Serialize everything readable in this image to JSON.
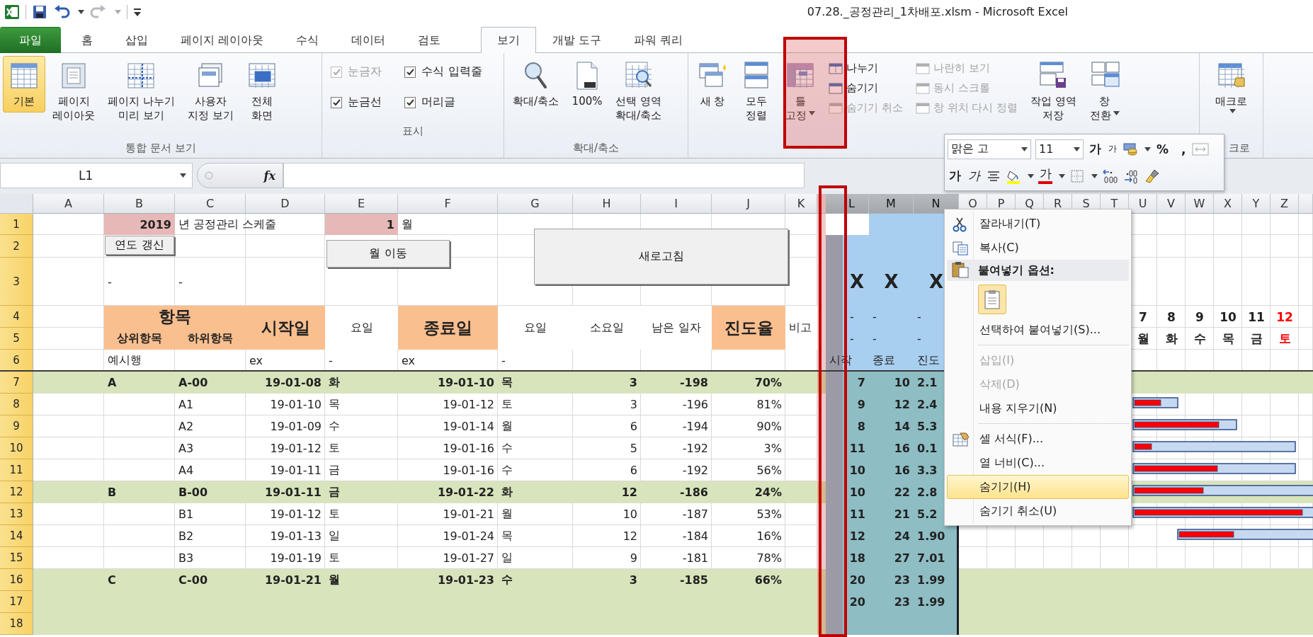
{
  "window": {
    "title": "07.28._공정관리_1차배포.xlsm  -  Microsoft Excel"
  },
  "tabs": [
    {
      "label": "파일",
      "kind": "file",
      "selected": false
    },
    {
      "label": "홈",
      "kind": "normal",
      "selected": false
    },
    {
      "label": "삽입",
      "kind": "normal",
      "selected": false
    },
    {
      "label": "페이지 레이아웃",
      "kind": "normal",
      "selected": false
    },
    {
      "label": "수식",
      "kind": "normal",
      "selected": false
    },
    {
      "label": "데이터",
      "kind": "normal",
      "selected": false
    },
    {
      "label": "검토",
      "kind": "normal",
      "selected": false
    },
    {
      "label": "보기",
      "kind": "normal",
      "selected": true
    },
    {
      "label": "개발 도구",
      "kind": "normal",
      "selected": false
    },
    {
      "label": "파워 쿼리",
      "kind": "normal",
      "selected": false
    }
  ],
  "ribbon": {
    "groups": [
      {
        "label": "통합 문서 보기",
        "items": [
          {
            "kind": "large",
            "lines": [
              "기본"
            ],
            "selected": true,
            "dropdown": false
          },
          {
            "kind": "large",
            "lines": [
              "페이지",
              "레이아웃"
            ],
            "selected": false,
            "dropdown": false
          },
          {
            "kind": "large",
            "lines": [
              "페이지 나누기",
              "미리 보기"
            ],
            "selected": false,
            "dropdown": false
          },
          {
            "kind": "large",
            "lines": [
              "사용자",
              "지정 보기"
            ],
            "selected": false,
            "dropdown": false
          },
          {
            "kind": "large",
            "lines": [
              "전체",
              "화면"
            ],
            "selected": false,
            "dropdown": false
          }
        ]
      },
      {
        "label": "표시",
        "items": [
          {
            "kind": "check",
            "label": "눈금자",
            "checked": true,
            "disabled": true
          },
          {
            "kind": "check",
            "label": "수식 입력줄",
            "checked": true,
            "disabled": false
          },
          {
            "kind": "check",
            "label": "눈금선",
            "checked": true,
            "disabled": false
          },
          {
            "kind": "check",
            "label": "머리글",
            "checked": true,
            "disabled": false
          }
        ]
      },
      {
        "label": "확대/축소",
        "items": [
          {
            "kind": "large",
            "lines": [
              "확대/축소"
            ],
            "selected": false,
            "dropdown": false
          },
          {
            "kind": "large",
            "lines": [
              "100%"
            ],
            "selected": false,
            "dropdown": false
          },
          {
            "kind": "large",
            "lines": [
              "선택 영역",
              "확대/축소"
            ],
            "selected": false,
            "dropdown": false
          }
        ]
      },
      {
        "items": [
          {
            "kind": "large",
            "lines": [
              "새 창"
            ],
            "selected": false,
            "dropdown": false
          },
          {
            "kind": "large",
            "lines": [
              "모두",
              "정렬"
            ],
            "selected": false,
            "dropdown": false
          },
          {
            "kind": "large",
            "lines": [
              "틀",
              "고정"
            ],
            "selected": false,
            "dropdown": true
          },
          {
            "kind": "stack",
            "items": [
              {
                "label": "나누기",
                "disabled": false
              },
              {
                "label": "숨기기",
                "disabled": false
              },
              {
                "label": "숨기기 취소",
                "disabled": true
              }
            ]
          },
          {
            "kind": "stack",
            "items": [
              {
                "label": "나란히 보기",
                "disabled": true
              },
              {
                "label": "동시 스크롤",
                "disabled": true
              },
              {
                "label": "창 위치 다시 정렬",
                "disabled": true
              }
            ]
          },
          {
            "kind": "large",
            "lines": [
              "작업 영역",
              "저장"
            ],
            "selected": false,
            "dropdown": false
          },
          {
            "kind": "large",
            "lines": [
              "창",
              "전환"
            ],
            "selected": false,
            "dropdown": true
          }
        ]
      },
      {
        "label": "크로",
        "items": [
          {
            "kind": "large",
            "lines": [
              "매크로"
            ],
            "selected": false,
            "dropdown": true
          }
        ]
      }
    ]
  },
  "formula_bar": {
    "name_box": "L1",
    "function_label": "fx"
  },
  "sheet": {
    "columns": [
      {
        "label": "A",
        "selected": false
      },
      {
        "label": "B",
        "selected": false
      },
      {
        "label": "C",
        "selected": false
      },
      {
        "label": "D",
        "selected": false
      },
      {
        "label": "E",
        "selected": false
      },
      {
        "label": "F",
        "selected": false
      },
      {
        "label": "G",
        "selected": false
      },
      {
        "label": "H",
        "selected": false
      },
      {
        "label": "I",
        "selected": false
      },
      {
        "label": "J",
        "selected": false
      },
      {
        "label": "K",
        "selected": false
      },
      {
        "label": "L",
        "selected": true
      },
      {
        "label": "M",
        "selected": true
      },
      {
        "label": "N",
        "selected": true
      },
      {
        "label": "O",
        "selected": false
      },
      {
        "label": "P",
        "selected": false
      },
      {
        "label": "Q",
        "selected": false
      },
      {
        "label": "R",
        "selected": false
      },
      {
        "label": "S",
        "selected": false
      },
      {
        "label": "T",
        "selected": false
      },
      {
        "label": "U",
        "selected": false
      },
      {
        "label": "V",
        "selected": false
      },
      {
        "label": "W",
        "selected": false
      },
      {
        "label": "X",
        "selected": false
      },
      {
        "label": "Y",
        "selected": false
      },
      {
        "label": "Z",
        "selected": false
      }
    ],
    "row_numbers": [
      {
        "label": "1",
        "selected": true
      },
      {
        "label": "2",
        "selected": true
      },
      {
        "label": "3",
        "selected": true
      },
      {
        "label": "4",
        "selected": true
      },
      {
        "label": "5",
        "selected": true
      },
      {
        "label": "6",
        "selected": true
      },
      {
        "label": "7",
        "selected": true
      },
      {
        "label": "8",
        "selected": true
      },
      {
        "label": "9",
        "selected": true
      },
      {
        "label": "10",
        "selected": true
      },
      {
        "label": "11",
        "selected": true
      },
      {
        "label": "12",
        "selected": true
      },
      {
        "label": "13",
        "selected": true
      },
      {
        "label": "14",
        "selected": true
      },
      {
        "label": "15",
        "selected": true
      },
      {
        "label": "16",
        "selected": true
      },
      {
        "label": "17",
        "selected": true
      },
      {
        "label": "18",
        "selected": true
      }
    ],
    "title_row": {
      "year": "2019",
      "title": "년 공정관리 스케줄",
      "month": "1",
      "month_unit": "월"
    },
    "buttons": [
      "연도 갱신",
      "월 이동",
      "새로고침"
    ],
    "row3": [
      "-",
      "-"
    ],
    "headers": {
      "item": "항목",
      "upper": "상위항목",
      "lower": "하위항목",
      "start": "시작일",
      "start_day": "요일",
      "end": "종료일",
      "end_day": "요일",
      "duration": "소요일",
      "remaining": "남은 일자",
      "progress": "진도율",
      "note": "비고"
    },
    "example_row": {
      "upper": "예시행",
      "start": "ex",
      "start_day": "-",
      "end": "ex",
      "end_day": "-"
    },
    "summary_headers": [
      [
        "X",
        "X",
        "X"
      ],
      [
        "-",
        "-",
        "-"
      ],
      [
        "-",
        "-",
        "-"
      ],
      [
        "시작",
        "종료",
        "진도"
      ]
    ],
    "days": [
      {
        "date": "7",
        "weekday": "월",
        "holiday": false
      },
      {
        "date": "8",
        "weekday": "화",
        "holiday": false
      },
      {
        "date": "9",
        "weekday": "수",
        "holiday": false
      },
      {
        "date": "10",
        "weekday": "목",
        "holiday": false
      },
      {
        "date": "11",
        "weekday": "금",
        "holiday": false
      },
      {
        "date": "12",
        "weekday": "토",
        "holiday": true
      }
    ],
    "rows": [
      {
        "kind": "group",
        "upper": "A",
        "lower": "A-00",
        "start": "19-01-08",
        "start_day": "화",
        "end": "19-01-10",
        "end_day": "목",
        "duration": "3",
        "remaining": "-198",
        "progress": "70%",
        "l": "7",
        "m": "10",
        "n": "2.1"
      },
      {
        "kind": "task",
        "lower": "A1",
        "start": "19-01-10",
        "start_day": "목",
        "end": "19-01-12",
        "end_day": "토",
        "duration": "3",
        "remaining": "-196",
        "progress": "81%",
        "l": "9",
        "m": "12",
        "n": "2.4"
      },
      {
        "kind": "task",
        "lower": "A2",
        "start": "19-01-09",
        "start_day": "수",
        "end": "19-01-14",
        "end_day": "월",
        "duration": "6",
        "remaining": "-194",
        "progress": "90%",
        "l": "8",
        "m": "14",
        "n": "5.3"
      },
      {
        "kind": "task",
        "lower": "A3",
        "start": "19-01-12",
        "start_day": "토",
        "end": "19-01-16",
        "end_day": "수",
        "duration": "5",
        "remaining": "-192",
        "progress": "3%",
        "l": "11",
        "m": "16",
        "n": "0.1"
      },
      {
        "kind": "task",
        "lower": "A4",
        "start": "19-01-11",
        "start_day": "금",
        "end": "19-01-16",
        "end_day": "수",
        "duration": "6",
        "remaining": "-192",
        "progress": "56%",
        "l": "10",
        "m": "16",
        "n": "3.3"
      },
      {
        "kind": "group",
        "upper": "B",
        "lower": "B-00",
        "start": "19-01-11",
        "start_day": "금",
        "end": "19-01-22",
        "end_day": "화",
        "duration": "12",
        "remaining": "-186",
        "progress": "24%",
        "l": "10",
        "m": "22",
        "n": "2.8"
      },
      {
        "kind": "task",
        "lower": "B1",
        "start": "19-01-12",
        "start_day": "토",
        "end": "19-01-21",
        "end_day": "월",
        "duration": "10",
        "remaining": "-187",
        "progress": "53%",
        "l": "11",
        "m": "21",
        "n": "5.2"
      },
      {
        "kind": "task",
        "lower": "B2",
        "start": "19-01-13",
        "start_day": "일",
        "end": "19-01-24",
        "end_day": "목",
        "duration": "12",
        "remaining": "-184",
        "progress": "16%",
        "l": "12",
        "m": "24",
        "n": "1.90"
      },
      {
        "kind": "task",
        "lower": "B3",
        "start": "19-01-19",
        "start_day": "토",
        "end": "19-01-27",
        "end_day": "일",
        "duration": "9",
        "remaining": "-181",
        "progress": "78%",
        "l": "18",
        "m": "27",
        "n": "7.01"
      },
      {
        "kind": "group",
        "upper": "C",
        "lower": "C-00",
        "start": "19-01-21",
        "start_day": "월",
        "end": "19-01-23",
        "end_day": "수",
        "duration": "3",
        "remaining": "-185",
        "progress": "66%",
        "l": "20",
        "m": "23",
        "n": "1.99"
      },
      {
        "kind": "group",
        "l": "20",
        "m": "23",
        "n": "1.99"
      },
      {
        "kind": "group"
      }
    ]
  },
  "context_menu": {
    "items": [
      {
        "kind": "item",
        "label": "잘라내기(T)",
        "disabled": false,
        "selected": false
      },
      {
        "kind": "item",
        "label": "복사(C)",
        "disabled": false,
        "selected": false
      },
      {
        "kind": "heading",
        "label": "붙여넣기 옵션:"
      },
      {
        "kind": "paste"
      },
      {
        "kind": "item",
        "label": "선택하여 붙여넣기(S)...",
        "disabled": false,
        "selected": false
      },
      {
        "kind": "separator"
      },
      {
        "kind": "item",
        "label": "삽입(I)",
        "disabled": true,
        "selected": false
      },
      {
        "kind": "item",
        "label": "삭제(D)",
        "disabled": true,
        "selected": false
      },
      {
        "kind": "item",
        "label": "내용 지우기(N)",
        "disabled": false,
        "selected": false
      },
      {
        "kind": "separator"
      },
      {
        "kind": "item",
        "label": "셀 서식(F)...",
        "disabled": false,
        "selected": false
      },
      {
        "kind": "item",
        "label": "열 너비(C)...",
        "disabled": false,
        "selected": false
      },
      {
        "kind": "item",
        "label": "숨기기(H)",
        "disabled": false,
        "selected": true
      },
      {
        "kind": "item",
        "label": "숨기기 취소(U)",
        "disabled": false,
        "selected": false
      }
    ]
  },
  "mini_toolbar": {
    "font": "맑은 고",
    "size": "11",
    "grow": "가",
    "shrink": "가",
    "percent": "%",
    "comma": ",",
    "bold": "가",
    "italic": "가",
    "font_color": "가"
  }
}
